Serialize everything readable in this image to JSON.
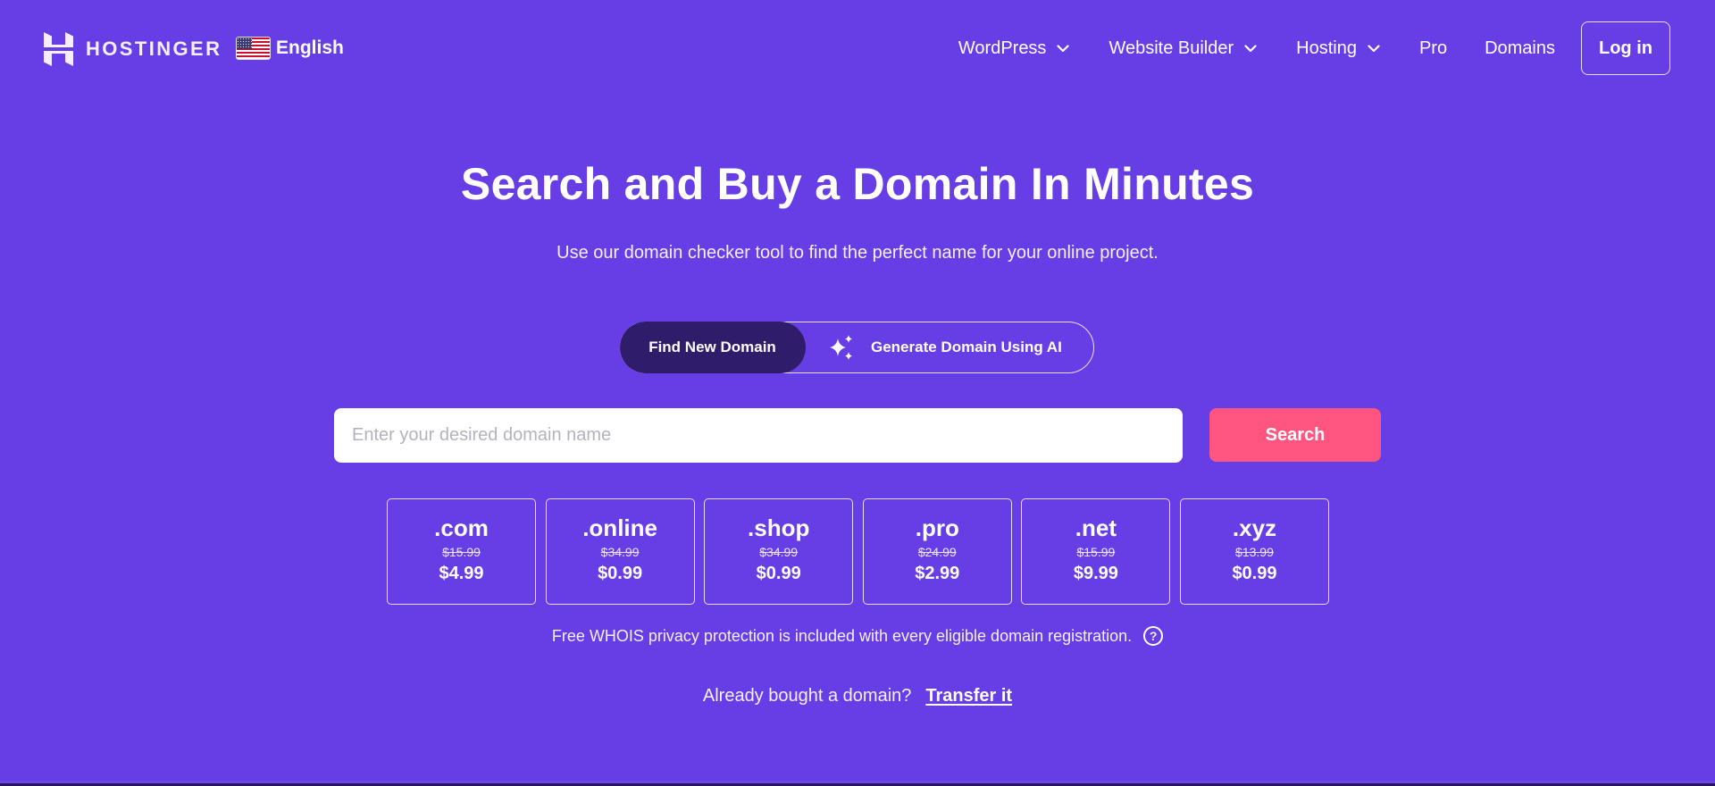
{
  "brand": {
    "name": "HOSTINGER",
    "accent": "#673DE6",
    "cta": "#FF5580",
    "toggle_active": "#2F1C6A"
  },
  "header": {
    "language": {
      "label": "English",
      "flag": "us-flag-icon"
    },
    "nav": [
      {
        "label": "WordPress",
        "has_dropdown": true
      },
      {
        "label": "Website Builder",
        "has_dropdown": true
      },
      {
        "label": "Hosting",
        "has_dropdown": true
      },
      {
        "label": "Pro",
        "has_dropdown": false
      },
      {
        "label": "Domains",
        "has_dropdown": false
      }
    ],
    "login_label": "Log in"
  },
  "hero": {
    "title": "Search and Buy a Domain In Minutes",
    "subtitle": "Use our domain checker tool to find the perfect name for your online project."
  },
  "mode_toggle": {
    "options": [
      {
        "label": "Find New Domain",
        "active": true
      },
      {
        "label": "Generate Domain Using AI",
        "active": false,
        "icon": "sparkles-icon"
      }
    ]
  },
  "search": {
    "value": "",
    "placeholder": "Enter your desired domain name",
    "button_label": "Search"
  },
  "tlds": [
    {
      "name": ".com",
      "old_price": "$15.99",
      "price": "$4.99"
    },
    {
      "name": ".online",
      "old_price": "$34.99",
      "price": "$0.99"
    },
    {
      "name": ".shop",
      "old_price": "$34.99",
      "price": "$0.99"
    },
    {
      "name": ".pro",
      "old_price": "$24.99",
      "price": "$2.99"
    },
    {
      "name": ".net",
      "old_price": "$15.99",
      "price": "$9.99"
    },
    {
      "name": ".xyz",
      "old_price": "$13.99",
      "price": "$0.99"
    }
  ],
  "whois_note": "Free WHOIS privacy protection is included with every eligible domain registration.",
  "help_glyph": "?",
  "transfer": {
    "prompt": "Already bought a domain?",
    "link_label": "Transfer it"
  }
}
